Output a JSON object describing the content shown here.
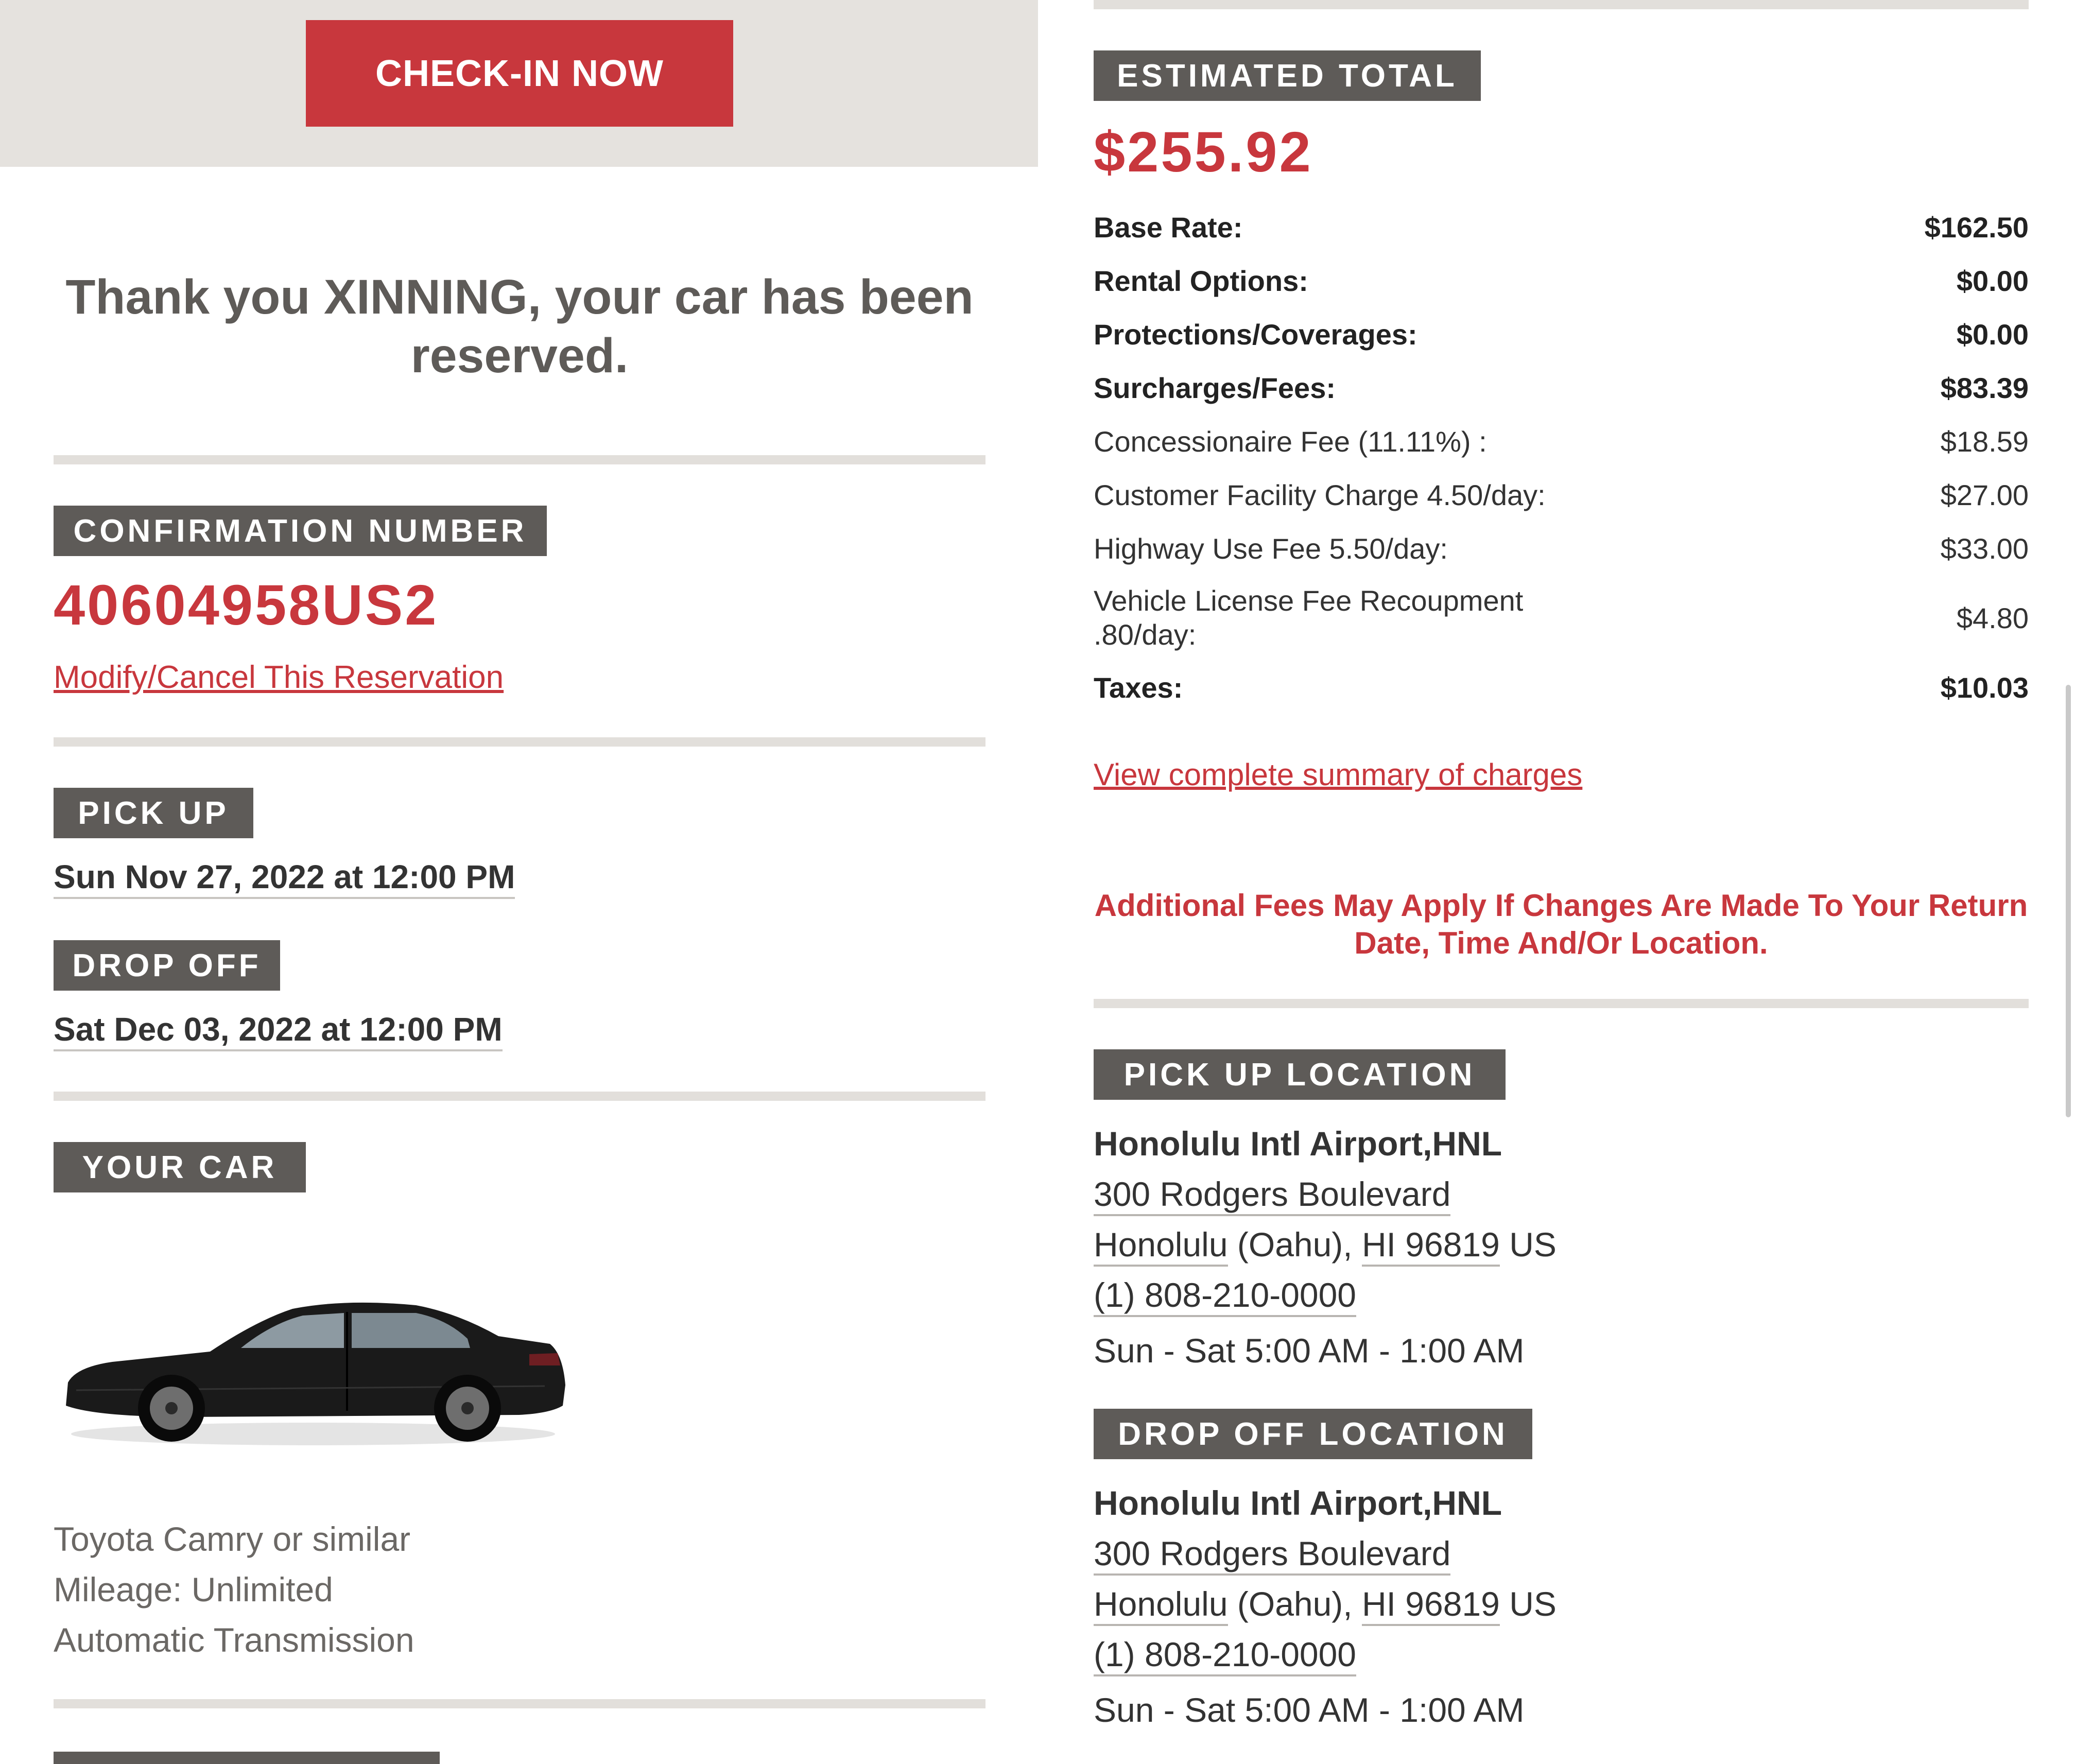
{
  "checkin": {
    "button_label": "CHECK-IN NOW"
  },
  "thanks_message": "Thank you XINNING, your car has been reserved.",
  "confirmation": {
    "label": "CONFIRMATION NUMBER",
    "number": "40604958US2",
    "modify_link": "Modify/Cancel This Reservation"
  },
  "pickup": {
    "label": "PICK UP",
    "datetime": "Sun Nov 27, 2022 at 12:00 PM"
  },
  "dropoff": {
    "label": "DROP OFF",
    "datetime": "Sat Dec 03, 2022 at 12:00 PM"
  },
  "car": {
    "label": "YOUR CAR",
    "model": "Toyota Camry or similar",
    "mileage": "Mileage: Unlimited",
    "transmission": "Automatic Transmission",
    "color": "#1a1a1a"
  },
  "estimate": {
    "label": "ESTIMATED TOTAL",
    "total": "$255.92",
    "rows": [
      {
        "label": "Base Rate:",
        "amount": "$162.50"
      },
      {
        "label": "Rental Options:",
        "amount": "$0.00"
      },
      {
        "label": "Protections/Coverages:",
        "amount": "$0.00"
      },
      {
        "label": "Surcharges/Fees:",
        "amount": "$83.39"
      },
      {
        "label": "Concessionaire Fee (11.11%) :",
        "amount": "$18.59"
      },
      {
        "label": "Customer Facility Charge 4.50/day:",
        "amount": "$27.00"
      },
      {
        "label": "Highway Use Fee 5.50/day:",
        "amount": "$33.00"
      },
      {
        "label": "Vehicle License Fee Recoupment .80/day:",
        "amount": "$4.80"
      },
      {
        "label": "Taxes:",
        "amount": "$10.03"
      }
    ],
    "summary_link": "View complete summary of charges",
    "notice": "Additional Fees May Apply If Changes Are Made To Your Return Date, Time And/Or Location."
  },
  "pickup_location": {
    "label": "PICK UP LOCATION",
    "name": "Honolulu Intl Airport,HNL",
    "street": "300 Rodgers Boulevard",
    "city": "Honolulu",
    "area": "(Oahu),",
    "state_zip": "HI 96819",
    "country": "US",
    "phone": "(1) 808-210-0000",
    "hours": "Sun - Sat 5:00 AM - 1:00 AM"
  },
  "dropoff_location": {
    "label": "DROP OFF LOCATION",
    "name": "Honolulu Intl Airport,HNL",
    "street": "300 Rodgers Boulevard",
    "city": "Honolulu",
    "area": "(Oahu),",
    "state_zip": "HI 96819",
    "country": "US",
    "phone": "(1) 808-210-0000",
    "hours": "Sun - Sat 5:00 AM - 1:00 AM"
  },
  "colors": {
    "brand_red": "#c8373d",
    "label_gray": "#5e5b58",
    "band_gray": "#e5e2de"
  }
}
